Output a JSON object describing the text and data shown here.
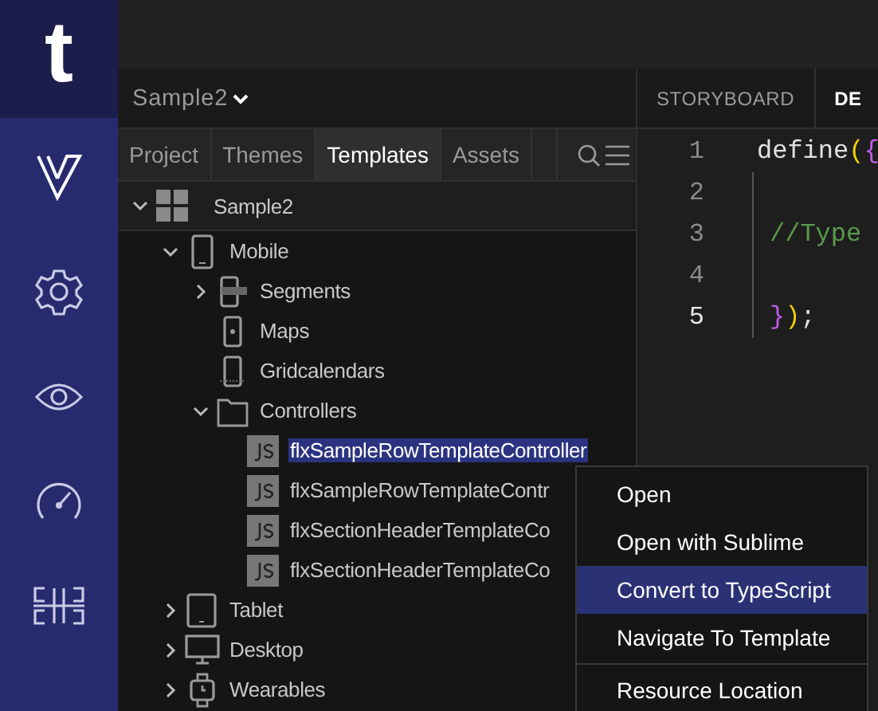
{
  "rail": {
    "logo": "t",
    "items": [
      {
        "kind": "logo"
      },
      {
        "kind": "settings"
      },
      {
        "kind": "preview"
      },
      {
        "kind": "gauge"
      },
      {
        "kind": "layout"
      }
    ]
  },
  "project": {
    "name": "Sample2"
  },
  "panel_tabs": [
    {
      "label": "Project",
      "selected": false
    },
    {
      "label": "Themes",
      "selected": false
    },
    {
      "label": "Templates",
      "selected": true
    },
    {
      "label": "Assets",
      "selected": false
    }
  ],
  "tree": [
    {
      "label": "Sample2",
      "kind": "workspace",
      "expanded": true,
      "selected": false,
      "children": [
        {
          "label": "Mobile",
          "kind": "phone",
          "expanded": true,
          "selected": false,
          "children": [
            {
              "label": "Segments",
              "kind": "segments",
              "expanded": false,
              "selected": false
            },
            {
              "label": "Maps",
              "kind": "map",
              "selected": false
            },
            {
              "label": "Gridcalendars",
              "kind": "grid",
              "selected": false
            },
            {
              "label": "Controllers",
              "kind": "folder",
              "expanded": true,
              "selected": false,
              "children": [
                {
                  "label": "flxSampleRowTemplateController",
                  "kind": "js",
                  "selected": true
                },
                {
                  "label": "flxSampleRowTemplateContr",
                  "kind": "js",
                  "selected": false
                },
                {
                  "label": "flxSectionHeaderTemplateCo",
                  "kind": "js",
                  "selected": false
                },
                {
                  "label": "flxSectionHeaderTemplateCo",
                  "kind": "js",
                  "selected": false
                }
              ]
            }
          ]
        },
        {
          "label": "Tablet",
          "kind": "tablet",
          "expanded": false,
          "selected": false
        },
        {
          "label": "Desktop",
          "kind": "desktop",
          "expanded": false,
          "selected": false
        },
        {
          "label": "Wearables",
          "kind": "watch",
          "expanded": false,
          "selected": false
        }
      ]
    }
  ],
  "editor_tabs": [
    {
      "label": "STORYBOARD",
      "selected": false
    },
    {
      "label": "DE",
      "selected": true
    }
  ],
  "code_lines": [
    {
      "number": "1",
      "current": false,
      "tokens": [
        {
          "text": "define",
          "kind": "plain"
        },
        {
          "text": "(",
          "kind": "paren"
        },
        {
          "text": "{",
          "kind": "brace"
        }
      ]
    },
    {
      "number": "2",
      "current": false
    },
    {
      "number": "3",
      "current": false,
      "tokens": [
        {
          "text": "//Type",
          "kind": "comment"
        }
      ]
    },
    {
      "number": "4",
      "current": false
    },
    {
      "number": "5",
      "current": true,
      "tokens": [
        {
          "text": "}",
          "kind": "brace"
        },
        {
          "text": ")",
          "kind": "paren"
        },
        {
          "text": ";",
          "kind": "plain"
        }
      ]
    }
  ],
  "context_menu": {
    "groups": [
      [
        {
          "label": "Open",
          "selected": false
        },
        {
          "label": "Open with Sublime",
          "selected": false
        },
        {
          "label": "Convert to TypeScript",
          "selected": true
        },
        {
          "label": "Navigate To Template",
          "selected": false
        }
      ],
      [
        {
          "label": "Resource Location",
          "selected": false
        }
      ]
    ]
  }
}
